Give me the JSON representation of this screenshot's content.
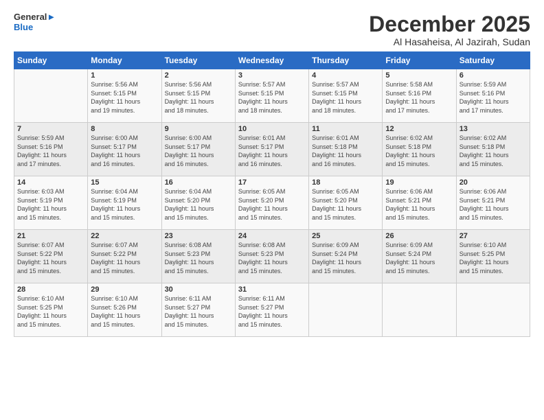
{
  "logo": {
    "line1": "General",
    "line2": "Blue"
  },
  "title": "December 2025",
  "subtitle": "Al Hasaheisa, Al Jazirah, Sudan",
  "headers": [
    "Sunday",
    "Monday",
    "Tuesday",
    "Wednesday",
    "Thursday",
    "Friday",
    "Saturday"
  ],
  "weeks": [
    [
      {
        "day": "",
        "info": ""
      },
      {
        "day": "1",
        "info": "Sunrise: 5:56 AM\nSunset: 5:15 PM\nDaylight: 11 hours\nand 19 minutes."
      },
      {
        "day": "2",
        "info": "Sunrise: 5:56 AM\nSunset: 5:15 PM\nDaylight: 11 hours\nand 18 minutes."
      },
      {
        "day": "3",
        "info": "Sunrise: 5:57 AM\nSunset: 5:15 PM\nDaylight: 11 hours\nand 18 minutes."
      },
      {
        "day": "4",
        "info": "Sunrise: 5:57 AM\nSunset: 5:15 PM\nDaylight: 11 hours\nand 18 minutes."
      },
      {
        "day": "5",
        "info": "Sunrise: 5:58 AM\nSunset: 5:16 PM\nDaylight: 11 hours\nand 17 minutes."
      },
      {
        "day": "6",
        "info": "Sunrise: 5:59 AM\nSunset: 5:16 PM\nDaylight: 11 hours\nand 17 minutes."
      }
    ],
    [
      {
        "day": "7",
        "info": "Sunrise: 5:59 AM\nSunset: 5:16 PM\nDaylight: 11 hours\nand 17 minutes."
      },
      {
        "day": "8",
        "info": "Sunrise: 6:00 AM\nSunset: 5:17 PM\nDaylight: 11 hours\nand 16 minutes."
      },
      {
        "day": "9",
        "info": "Sunrise: 6:00 AM\nSunset: 5:17 PM\nDaylight: 11 hours\nand 16 minutes."
      },
      {
        "day": "10",
        "info": "Sunrise: 6:01 AM\nSunset: 5:17 PM\nDaylight: 11 hours\nand 16 minutes."
      },
      {
        "day": "11",
        "info": "Sunrise: 6:01 AM\nSunset: 5:18 PM\nDaylight: 11 hours\nand 16 minutes."
      },
      {
        "day": "12",
        "info": "Sunrise: 6:02 AM\nSunset: 5:18 PM\nDaylight: 11 hours\nand 15 minutes."
      },
      {
        "day": "13",
        "info": "Sunrise: 6:02 AM\nSunset: 5:18 PM\nDaylight: 11 hours\nand 15 minutes."
      }
    ],
    [
      {
        "day": "14",
        "info": "Sunrise: 6:03 AM\nSunset: 5:19 PM\nDaylight: 11 hours\nand 15 minutes."
      },
      {
        "day": "15",
        "info": "Sunrise: 6:04 AM\nSunset: 5:19 PM\nDaylight: 11 hours\nand 15 minutes."
      },
      {
        "day": "16",
        "info": "Sunrise: 6:04 AM\nSunset: 5:20 PM\nDaylight: 11 hours\nand 15 minutes."
      },
      {
        "day": "17",
        "info": "Sunrise: 6:05 AM\nSunset: 5:20 PM\nDaylight: 11 hours\nand 15 minutes."
      },
      {
        "day": "18",
        "info": "Sunrise: 6:05 AM\nSunset: 5:20 PM\nDaylight: 11 hours\nand 15 minutes."
      },
      {
        "day": "19",
        "info": "Sunrise: 6:06 AM\nSunset: 5:21 PM\nDaylight: 11 hours\nand 15 minutes."
      },
      {
        "day": "20",
        "info": "Sunrise: 6:06 AM\nSunset: 5:21 PM\nDaylight: 11 hours\nand 15 minutes."
      }
    ],
    [
      {
        "day": "21",
        "info": "Sunrise: 6:07 AM\nSunset: 5:22 PM\nDaylight: 11 hours\nand 15 minutes."
      },
      {
        "day": "22",
        "info": "Sunrise: 6:07 AM\nSunset: 5:22 PM\nDaylight: 11 hours\nand 15 minutes."
      },
      {
        "day": "23",
        "info": "Sunrise: 6:08 AM\nSunset: 5:23 PM\nDaylight: 11 hours\nand 15 minutes."
      },
      {
        "day": "24",
        "info": "Sunrise: 6:08 AM\nSunset: 5:23 PM\nDaylight: 11 hours\nand 15 minutes."
      },
      {
        "day": "25",
        "info": "Sunrise: 6:09 AM\nSunset: 5:24 PM\nDaylight: 11 hours\nand 15 minutes."
      },
      {
        "day": "26",
        "info": "Sunrise: 6:09 AM\nSunset: 5:24 PM\nDaylight: 11 hours\nand 15 minutes."
      },
      {
        "day": "27",
        "info": "Sunrise: 6:10 AM\nSunset: 5:25 PM\nDaylight: 11 hours\nand 15 minutes."
      }
    ],
    [
      {
        "day": "28",
        "info": "Sunrise: 6:10 AM\nSunset: 5:25 PM\nDaylight: 11 hours\nand 15 minutes."
      },
      {
        "day": "29",
        "info": "Sunrise: 6:10 AM\nSunset: 5:26 PM\nDaylight: 11 hours\nand 15 minutes."
      },
      {
        "day": "30",
        "info": "Sunrise: 6:11 AM\nSunset: 5:27 PM\nDaylight: 11 hours\nand 15 minutes."
      },
      {
        "day": "31",
        "info": "Sunrise: 6:11 AM\nSunset: 5:27 PM\nDaylight: 11 hours\nand 15 minutes."
      },
      {
        "day": "",
        "info": ""
      },
      {
        "day": "",
        "info": ""
      },
      {
        "day": "",
        "info": ""
      }
    ]
  ]
}
